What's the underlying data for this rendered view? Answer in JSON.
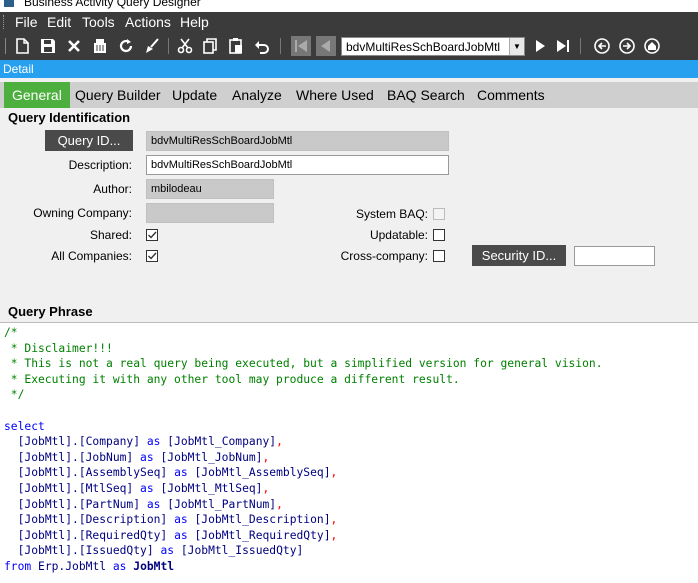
{
  "window": {
    "title": "Business Activity Query Designer"
  },
  "menu": [
    "File",
    "Edit",
    "Tools",
    "Actions",
    "Help"
  ],
  "toolbar": {
    "query_combo_value": "bdvMultiResSchBoardJobMtl"
  },
  "detail_label": "Detail",
  "tabs": [
    "General",
    "Query Builder",
    "Update",
    "Analyze",
    "Where Used",
    "BAQ Search",
    "Comments"
  ],
  "query_identification": {
    "heading": "Query Identification",
    "query_id_button": "Query ID...",
    "query_id_value": "bdvMultiResSchBoardJobMtl",
    "description_label": "Description:",
    "description_value": "bdvMultiResSchBoardJobMtl",
    "author_label": "Author:",
    "author_value": "mbilodeau",
    "owning_company_label": "Owning Company:",
    "owning_company_value": "",
    "shared_label": "Shared:",
    "shared_checked": true,
    "all_companies_label": "All Companies:",
    "all_companies_checked": true,
    "system_baq_label": "System BAQ:",
    "system_baq_checked": false,
    "updatable_label": "Updatable:",
    "updatable_checked": false,
    "cross_company_label": "Cross-company:",
    "cross_company_checked": false,
    "security_id_button": "Security ID...",
    "security_id_value": ""
  },
  "query_phrase": {
    "heading": "Query Phrase",
    "comment_lines": [
      "/*",
      " * Disclaimer!!!",
      " * This is not a real query being executed, but a simplified version for general vision.",
      " * Executing it with any other tool may produce a different result.",
      " */"
    ],
    "select_keyword": "select",
    "columns": [
      {
        "source": "[JobMtl].[Company]",
        "alias": "[JobMtl_Company]"
      },
      {
        "source": "[JobMtl].[JobNum]",
        "alias": "[JobMtl_JobNum]"
      },
      {
        "source": "[JobMtl].[AssemblySeq]",
        "alias": "[JobMtl_AssemblySeq]"
      },
      {
        "source": "[JobMtl].[MtlSeq]",
        "alias": "[JobMtl_MtlSeq]"
      },
      {
        "source": "[JobMtl].[PartNum]",
        "alias": "[JobMtl_PartNum]"
      },
      {
        "source": "[JobMtl].[Description]",
        "alias": "[JobMtl_Description]"
      },
      {
        "source": "[JobMtl].[RequiredQty]",
        "alias": "[JobMtl_RequiredQty]"
      },
      {
        "source": "[JobMtl].[IssuedQty]",
        "alias": "[JobMtl_IssuedQty]"
      }
    ],
    "from_keyword": "from",
    "from_table": "Erp.JobMtl",
    "as_keyword": "as",
    "from_alias": "JobMtl"
  }
}
